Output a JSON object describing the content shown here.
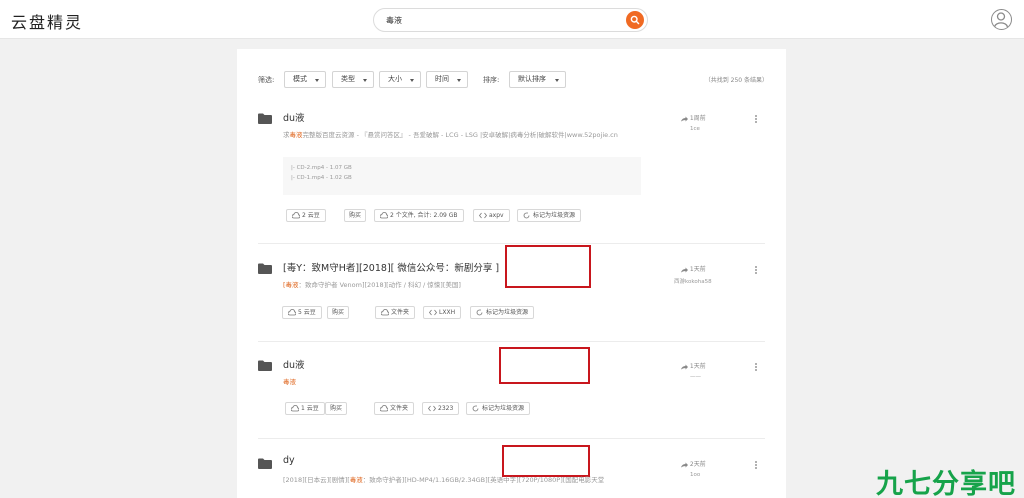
{
  "app": {
    "logo": "云盘精灵"
  },
  "search": {
    "value": "毒液"
  },
  "filters": {
    "label": "筛选:",
    "buttons": [
      "模式",
      "类型",
      "大小",
      "时间"
    ],
    "sort_label": "排序:",
    "sort_value": "默认排序",
    "result_count": "（共找到 250 条结果）"
  },
  "results": [
    {
      "title": "du液",
      "desc_pre": "求",
      "desc_hl": "毒液",
      "desc_post": "完整版百度云资源 - 『悬赏问答区』 - 吾爱破解 - LCG - LSG |安卓破解|病毒分析|破解软件|www.52pojie.cn",
      "files": [
        "|- CD-2.mp4 - 1.07 GB",
        "|- CD-1.mp4 - 1.02 GB"
      ],
      "time": "1周前",
      "user": "1ce",
      "beans": "2 云豆",
      "buy": "购买",
      "info": "2 个文件, 合计: 2.09 GB",
      "code": "axpv",
      "report": "标记为垃圾资源"
    },
    {
      "title": "[毒Y：致M守H者][2018][ 微信公众号：新剧分享 ]",
      "desc_pre": "",
      "desc_hl": "[毒液",
      "desc_post": "：致命守护者 Venom][2018][动作 / 科幻 / 惊悚][美国]",
      "time": "1天前",
      "user": "西游kokoha58",
      "beans": "5 云豆",
      "buy": "购买",
      "info": "文件夹",
      "code": "LXXH",
      "report": "标记为垃圾资源"
    },
    {
      "title": "du液",
      "desc_pre": "",
      "desc_hl": "毒液",
      "desc_post": "",
      "time": "1天前",
      "user": "——",
      "beans": "1 云豆",
      "buy": "购买",
      "info": "文件夹",
      "code": "2323",
      "report": "标记为垃圾资源"
    },
    {
      "title": "dy",
      "desc_pre": "[2018][日本云][剧情][",
      "desc_hl": "毒液",
      "desc_post": "：致命守护者][HD-MP4/1.16GB/2.34GB][英语中字][720P/1080P][国配电影天堂",
      "time": "2天前",
      "user": "1oo"
    }
  ],
  "watermark": "九七分享吧",
  "colors": {
    "accent": "#f06a23",
    "highlight_box": "#c8161d",
    "keyword": "#e06a24"
  }
}
